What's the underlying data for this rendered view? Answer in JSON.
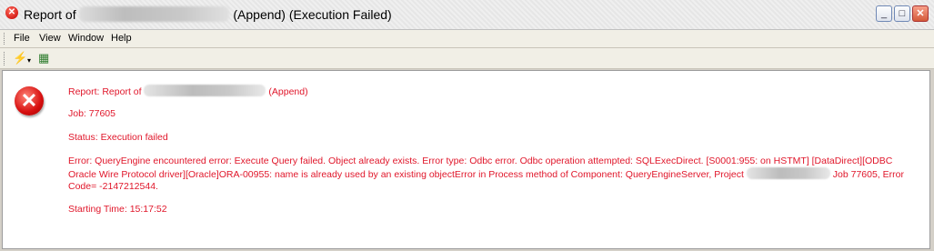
{
  "window": {
    "title_prefix": "Report of",
    "title_suffix": "(Append) (Execution Failed)",
    "buttons": {
      "minimize": "_",
      "maximize": "□",
      "close": "✕"
    }
  },
  "menu": [
    "File",
    "View",
    "Window",
    "Help"
  ],
  "toolbar": {
    "icons": [
      "wand-icon",
      "export-icon"
    ]
  },
  "report": {
    "report_prefix": "Report: Report of",
    "report_suffix": "(Append)",
    "job": "Job: 77605",
    "status": "Status: Execution failed",
    "error_part1": "Error: QueryEngine encountered error: Execute Query failed. Object already exists. Error type: Odbc error. Odbc operation attempted: SQLExecDirect. [S0001:955: on HSTMT] [DataDirect][ODBC Oracle Wire Protocol driver][Oracle]ORA-00955: name is already used by an existing objectError in Process method of Component: QueryEngineServer, Project",
    "error_part2": "Job 77605, Error Code= -2147212544.",
    "starting_time": "Starting Time: 15:17:52"
  },
  "colors": {
    "error_text": "#e0162a",
    "window_bg": "#d4d0c8"
  }
}
